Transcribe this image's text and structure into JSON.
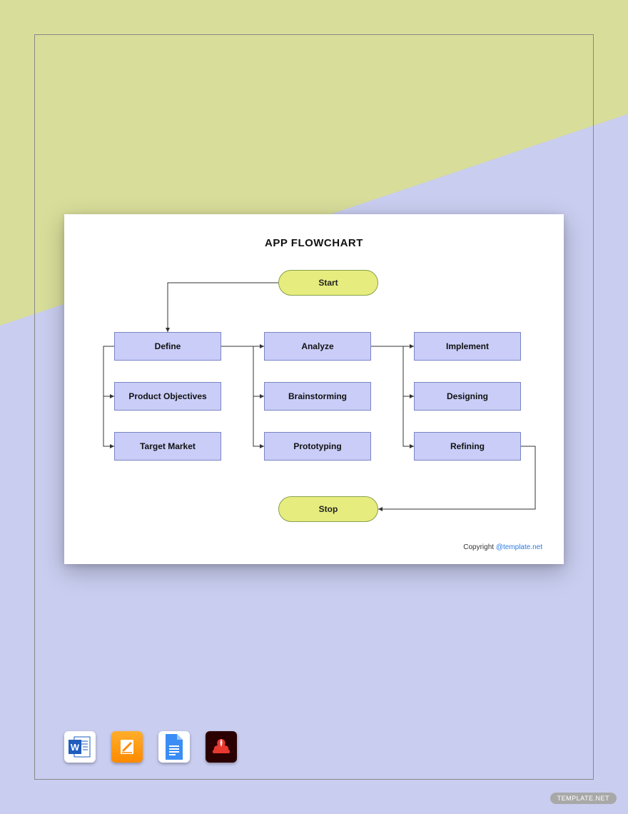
{
  "flowchart": {
    "title": "APP FLOWCHART",
    "start": "Start",
    "stop": "Stop",
    "columns": [
      {
        "head": "Define",
        "sub1": "Product Objectives",
        "sub2": "Target Market"
      },
      {
        "head": "Analyze",
        "sub1": "Brainstorming",
        "sub2": "Prototyping"
      },
      {
        "head": "Implement",
        "sub1": "Designing",
        "sub2": "Refining"
      }
    ],
    "copyright_label": "Copyright ",
    "copyright_link": "@template.net"
  },
  "apps": {
    "word": "Word",
    "pages": "Pages",
    "gdocs": "Google Docs",
    "pdf": "PDF"
  },
  "watermark": "TEMPLATE.NET"
}
